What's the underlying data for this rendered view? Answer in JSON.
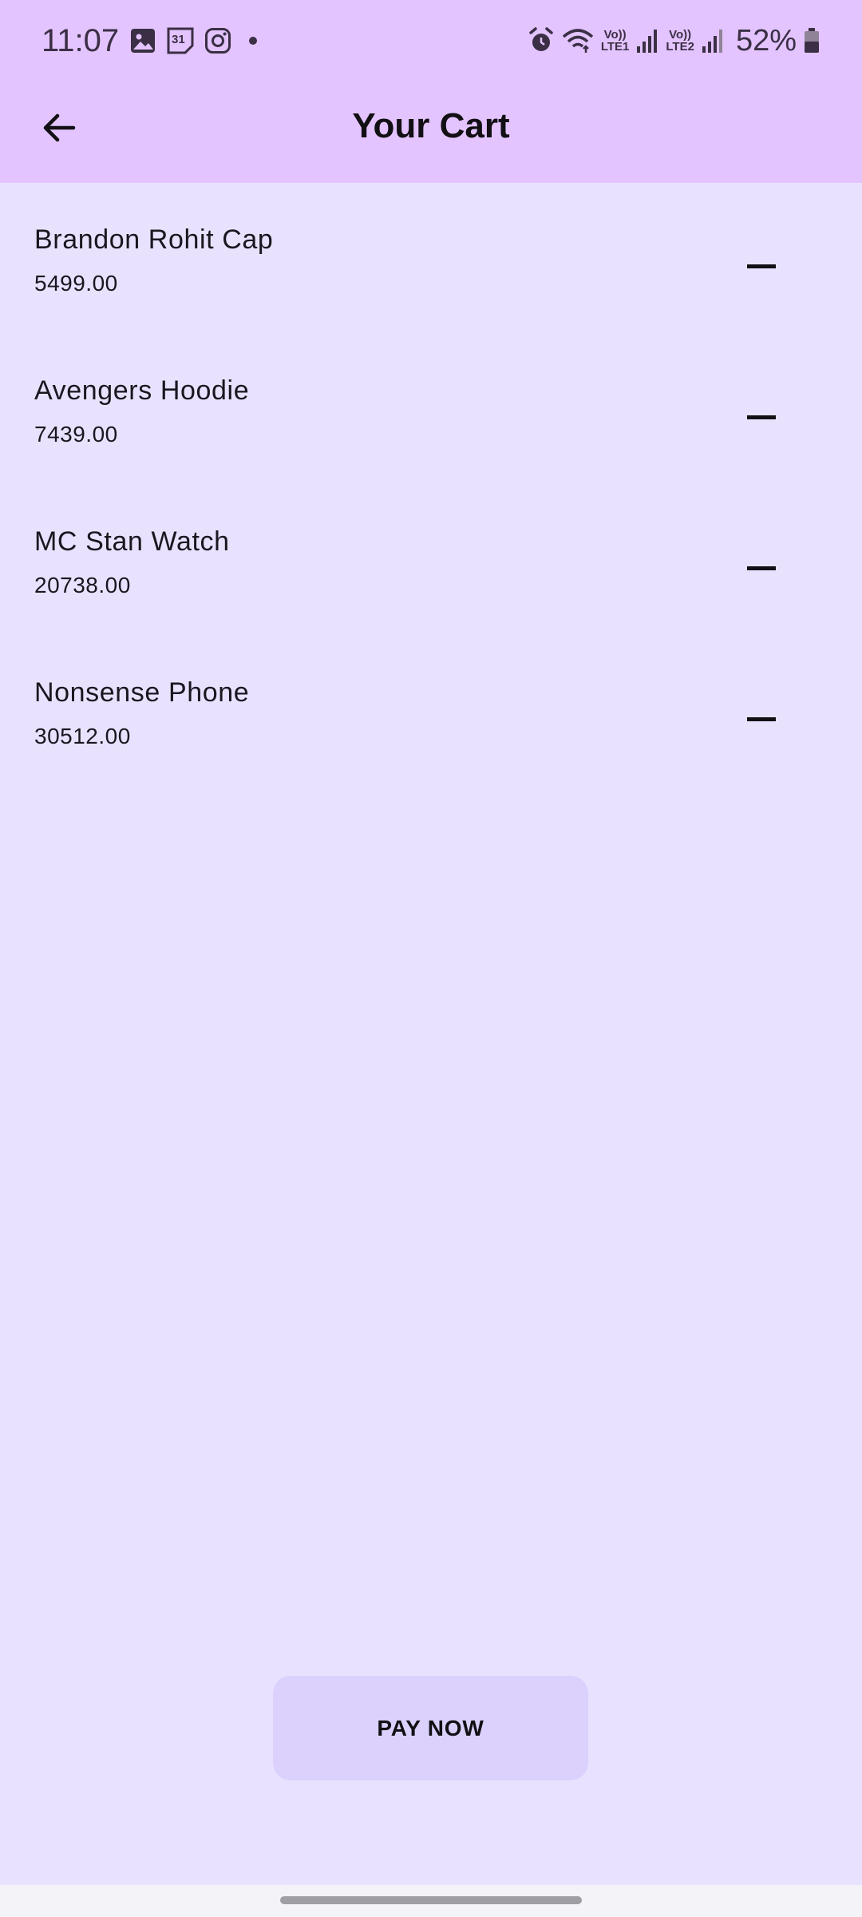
{
  "status_bar": {
    "time": "11:07",
    "notification_icons": [
      "gallery-icon",
      "calendar-icon",
      "instagram-icon",
      "dot-icon"
    ],
    "calendar_day": "31",
    "system_icons": [
      "alarm-icon",
      "wifi-icon",
      "signal-icon",
      "signal-icon",
      "battery-icon"
    ],
    "sim1_label_top": "Vo))",
    "sim1_label_bottom": "LTE1",
    "sim2_label_top": "Vo))",
    "sim2_label_bottom": "LTE2",
    "battery": "52%"
  },
  "app_bar": {
    "title": "Your Cart",
    "back_icon": "arrow-left-icon",
    "background": "#e3c4ff"
  },
  "cart": {
    "items": [
      {
        "name": "Brandon Rohit Cap",
        "price": "5499.00"
      },
      {
        "name": "Avengers Hoodie",
        "price": "7439.00"
      },
      {
        "name": "MC Stan Watch",
        "price": "20738.00"
      },
      {
        "name": "Nonsense Phone",
        "price": "30512.00"
      }
    ],
    "remove_icon": "minus-icon"
  },
  "actions": {
    "pay_label": "PAY NOW"
  },
  "colors": {
    "background": "#e9e2ff",
    "button": "#dcd1fd",
    "text": "#121014"
  }
}
